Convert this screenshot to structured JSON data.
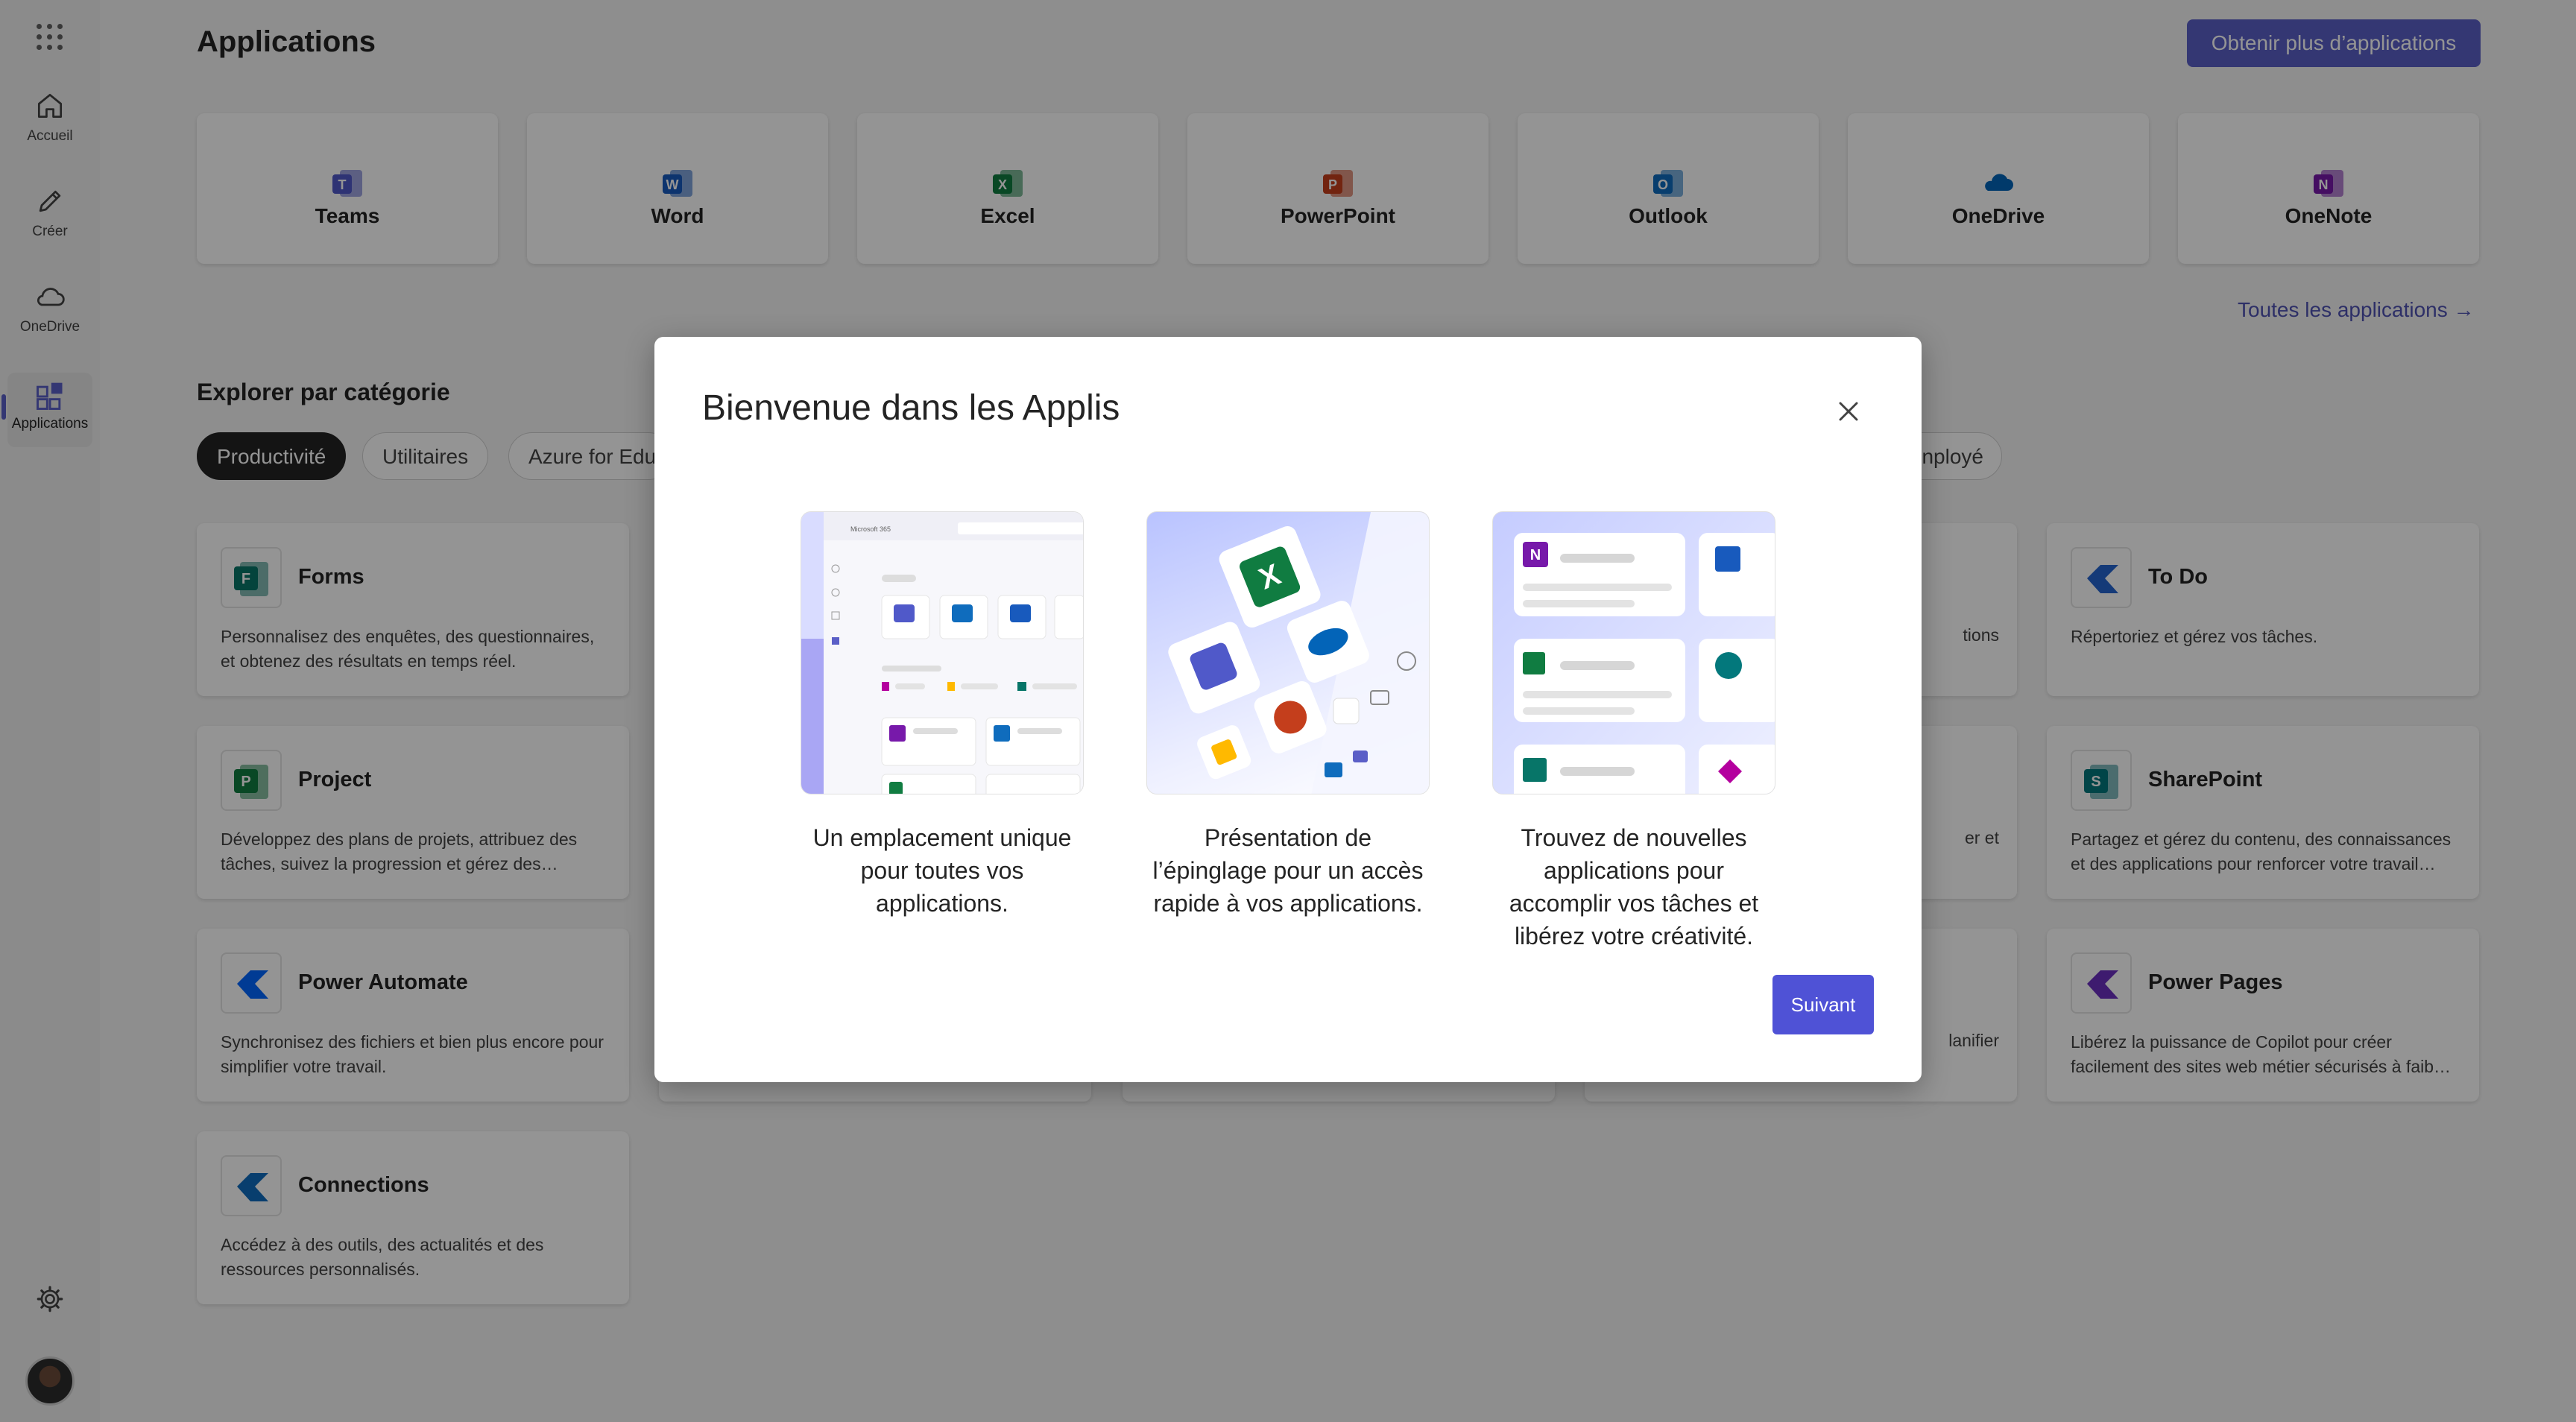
{
  "rail": {
    "items": [
      {
        "label": "Accueil",
        "icon": "home-icon"
      },
      {
        "label": "Créer",
        "icon": "pen-icon"
      },
      {
        "label": "OneDrive",
        "icon": "cloud-icon"
      },
      {
        "label": "Applications",
        "icon": "apps-icon",
        "active": true
      }
    ]
  },
  "header": {
    "title": "Applications",
    "get_more_label": "Obtenir plus d’applications"
  },
  "apps": [
    {
      "name": "Teams",
      "color": "#5059c9",
      "letter": "T"
    },
    {
      "name": "Word",
      "color": "#185abd",
      "letter": "W"
    },
    {
      "name": "Excel",
      "color": "#107c41",
      "letter": "X"
    },
    {
      "name": "PowerPoint",
      "color": "#c43e1c",
      "letter": "P"
    },
    {
      "name": "Outlook",
      "color": "#0f6cbd",
      "letter": "O"
    },
    {
      "name": "OneDrive",
      "color": "#0364b8",
      "letter": ""
    },
    {
      "name": "OneNote",
      "color": "#7719aa",
      "letter": "N"
    }
  ],
  "all_apps_label": "Toutes les applications →",
  "explore": {
    "title": "Explorer par catégorie",
    "chips": [
      "Productivité",
      "Utilitaires",
      "Azure for Edu"
    ],
    "chip_right": "nployé"
  },
  "cards": [
    {
      "title": "Forms",
      "desc": "Personnalisez des enquêtes, des questionnaires, et obtenez des résultats en temps réel.",
      "color": "#077568",
      "letter": "F"
    },
    {
      "title": "Project",
      "desc": "Développez des plans de projets, attribuez des tâches, suivez la progression et gérez des…",
      "color": "#107c41",
      "letter": "P"
    },
    {
      "title": "Power Automate",
      "desc": "Synchronisez des fichiers et bien plus encore pour simplifier votre travail.",
      "color": "#0066ff",
      "letter": ""
    },
    {
      "title": "Connections",
      "desc": "Accédez à des outils, des actualités et des ressources personnalisés.",
      "color": "#0f6cbd",
      "letter": ""
    },
    {
      "title": "To Do",
      "desc": "Répertoriez et gérez vos tâches.",
      "color": "#2564cf",
      "letter": ""
    },
    {
      "title": "SharePoint",
      "desc": "Partagez et gérez du contenu, des connaissances et des applications pour renforcer votre travail…",
      "color": "#03787c",
      "letter": "S"
    },
    {
      "title": "Power Pages",
      "desc": "Libérez la puissance de Copilot pour créer facilement des sites web métier sécurisés à faib…",
      "color": "#6b2fbf",
      "letter": ""
    }
  ],
  "partial_cards": [
    "tions",
    "er et",
    "lanifier"
  ],
  "modal": {
    "title": "Bienvenue dans les Applis",
    "features": [
      {
        "caption": "Un emplacement unique pour toutes vos applications.",
        "header_text": "Microsoft 365"
      },
      {
        "caption": "Présentation de l’épinglage pour un accès rapide à vos applications."
      },
      {
        "caption": "Trouvez de nouvelles applications pour accomplir vos tâches et libérez votre créativité."
      }
    ],
    "next_label": "Suivant"
  }
}
